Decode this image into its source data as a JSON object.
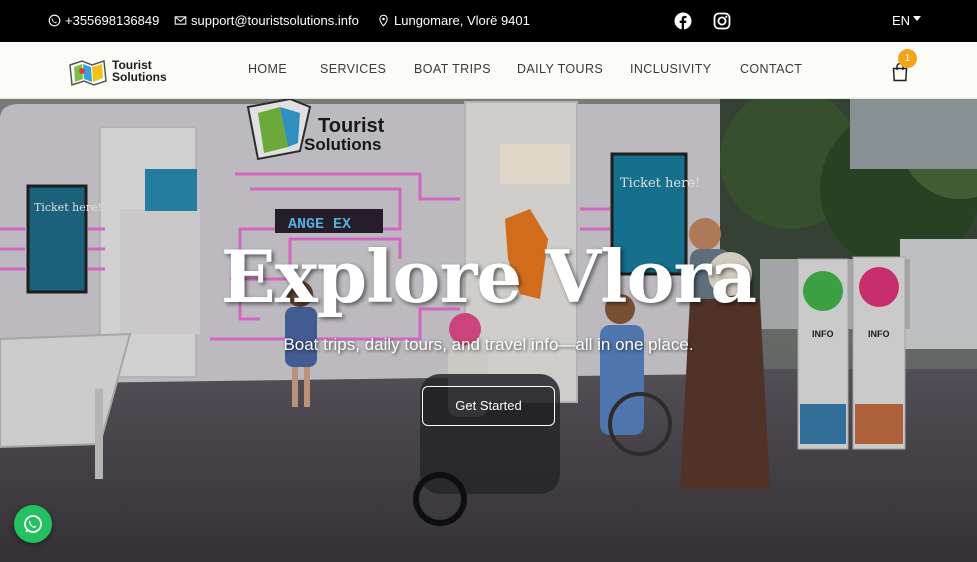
{
  "topbar": {
    "phone": "+355698136849",
    "email": "support@touristsolutions.info",
    "address": "Lungomare, Vlorë 9401",
    "social": [
      "facebook-icon",
      "instagram-icon"
    ],
    "language": "EN"
  },
  "nav": {
    "logo_line1": "Tourist",
    "logo_line2": "Solutions",
    "items": [
      {
        "label": "HOME"
      },
      {
        "label": "SERVICES"
      },
      {
        "label": "BOAT TRIPS"
      },
      {
        "label": "DAILY TOURS"
      },
      {
        "label": "INCLUSIVITY"
      },
      {
        "label": "CONTACT"
      }
    ],
    "cart_count": "1"
  },
  "hero": {
    "title": "Explore Vlora",
    "subtitle": "Boat trips, daily tours, and travel info—all in one place.",
    "cta": "Get Started",
    "booth_sign_line1": "Tourist",
    "booth_sign_line2": "Solutions",
    "screen_left": "Ticket here!",
    "screen_right": "Ticket here!",
    "led_text": "ANGE   EX",
    "info_label": "INFO"
  },
  "colors": {
    "topbar_bg": "#000000",
    "nav_bg": "#fbfbf8",
    "badge": "#f5a418",
    "whatsapp": "#25c062"
  }
}
